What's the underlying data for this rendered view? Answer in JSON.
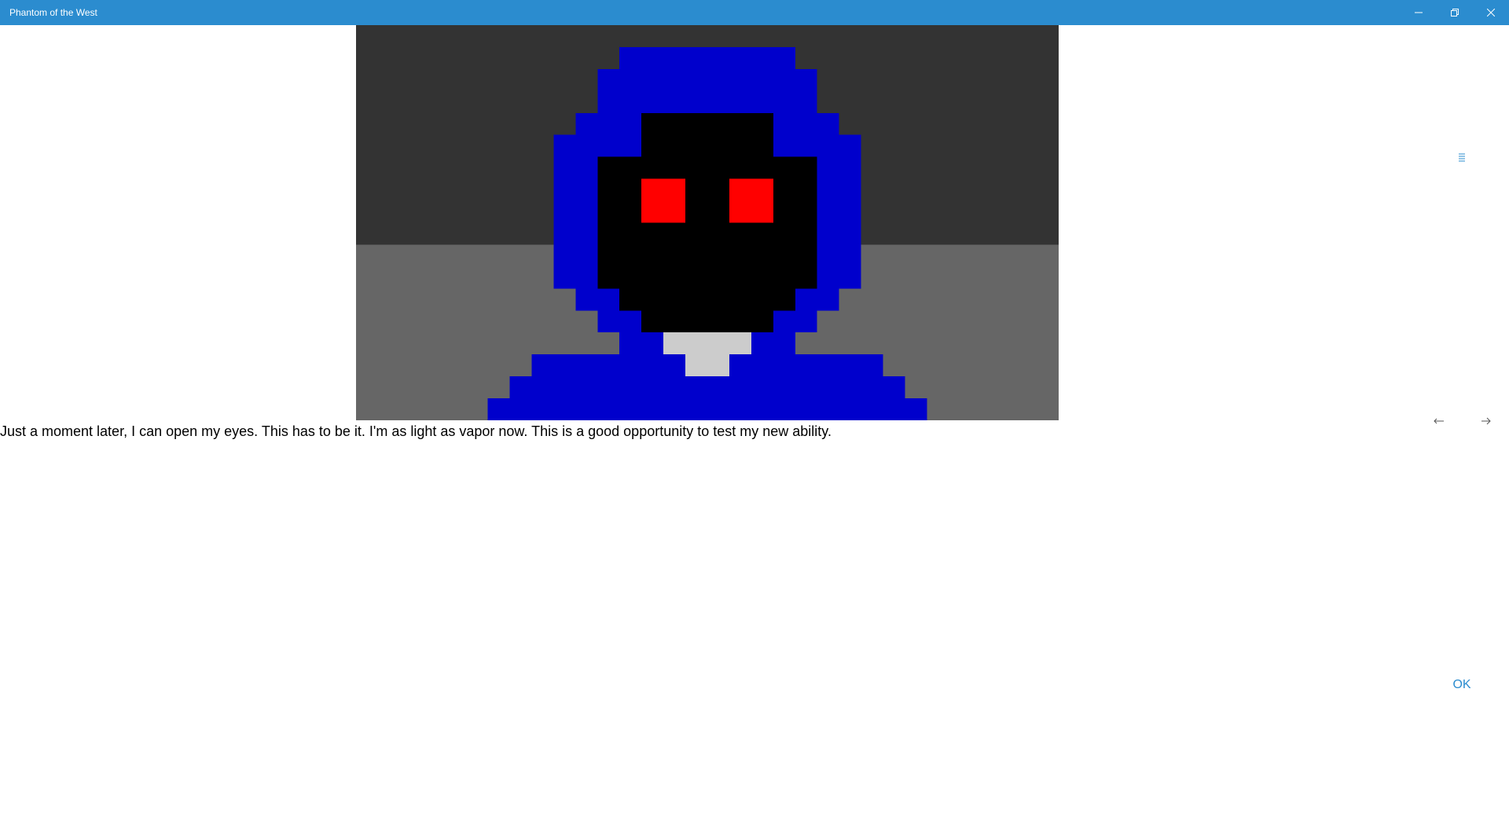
{
  "window": {
    "title": "Phantom of the West",
    "controls": [
      "minimize-icon",
      "restore-icon",
      "close-icon"
    ],
    "titlebar_color": "#2b8ccf"
  },
  "scene": {
    "description_icon": "hooded-phantom-pixel-art",
    "colors": {
      "wall": "#333333",
      "floor": "#666666",
      "hood": "#0000cc",
      "face": "#000000",
      "eyes": "#ff0000",
      "collar": "#cccccc"
    }
  },
  "story": {
    "text": "Just a moment later, I can open my eyes. This has to be it. I'm as light as vapor now. This is a good opportunity to test my new ability."
  },
  "controls": {
    "menu_icon": "hamburger-menu-icon",
    "back_icon": "arrow-left-icon",
    "forward_icon": "arrow-right-icon",
    "ok_label": "OK"
  },
  "accent_color": "#2b8ccf"
}
